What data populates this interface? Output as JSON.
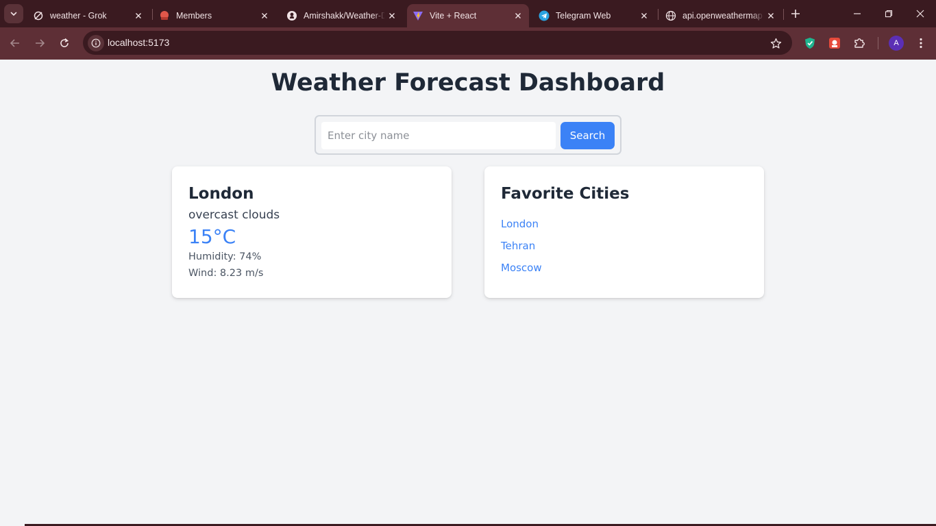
{
  "browser": {
    "tabs": [
      {
        "title": "weather - Grok",
        "icon": "grok-icon"
      },
      {
        "title": "Members",
        "icon": "members-icon"
      },
      {
        "title": "Amirshakk/Weather-D",
        "icon": "github-icon"
      },
      {
        "title": "Vite + React",
        "icon": "vite-icon",
        "active": true
      },
      {
        "title": "Telegram Web",
        "icon": "telegram-icon"
      },
      {
        "title": "api.openweathermap",
        "icon": "globe-icon"
      }
    ],
    "url": "localhost:5173",
    "profile_initial": "A",
    "colors": {
      "frame": "#3a1a20",
      "toolbar": "#5e2f36"
    }
  },
  "app": {
    "title": "Weather Forecast Dashboard",
    "search": {
      "placeholder": "Enter city name",
      "value": "",
      "button_label": "Search"
    },
    "weather": {
      "city": "London",
      "description": "overcast clouds",
      "temperature": "15°C",
      "humidity": "Humidity: 74%",
      "wind": "Wind: 8.23 m/s"
    },
    "favorites": {
      "title": "Favorite Cities",
      "cities": [
        "London",
        "Tehran",
        "Moscow"
      ]
    },
    "colors": {
      "accent": "#3b82f6",
      "background": "#f3f4f6",
      "heading": "#1f2937"
    }
  }
}
